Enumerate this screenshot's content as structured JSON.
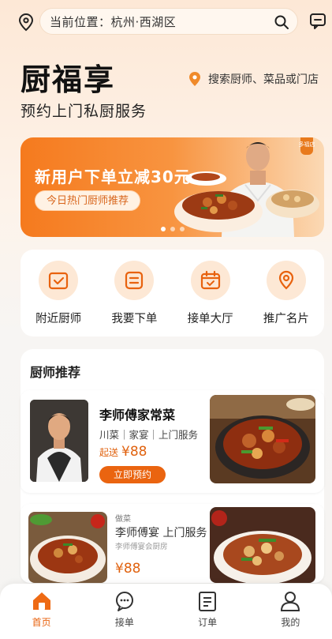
{
  "header": {
    "location_text": "当前位置：杭州·西湖区",
    "location_icon": "location-pin-icon",
    "search_icon": "search-icon",
    "message_icon": "message-icon"
  },
  "brand": {
    "title": "厨福享",
    "subtitle": "预约上门私厨服务",
    "search_link": "搜索厨师、菜品或门店"
  },
  "banner": {
    "title": "新用户下单立减30元",
    "chip": "今日热门厨师推荐",
    "badge": "多福店"
  },
  "quick_actions": [
    {
      "label": "附近厨师",
      "icon": "calendar-check-icon"
    },
    {
      "label": "我要下单",
      "icon": "order-list-icon"
    },
    {
      "label": "接单大厅",
      "icon": "folder-calendar-icon"
    },
    {
      "label": "推广名片",
      "icon": "map-pin-icon"
    }
  ],
  "section": {
    "title": "厨师推荐"
  },
  "chef_cards": [
    {
      "title": "李师傅家常菜",
      "tags": "川菜｜家宴｜上门服务",
      "price_prefix": "起送",
      "price": "¥88",
      "button": "立即预约"
    },
    {
      "tag": "做菜",
      "title": "李师傅宴 上门服务",
      "sub": "李师傅宴会厨房",
      "price": "¥88"
    }
  ],
  "tabbar": [
    {
      "label": "首页",
      "icon": "home-icon",
      "active": true
    },
    {
      "label": "接单",
      "icon": "chat-icon",
      "active": false
    },
    {
      "label": "订单",
      "icon": "clipboard-icon",
      "active": false
    },
    {
      "label": "我的",
      "icon": "user-icon",
      "active": false
    }
  ],
  "colors": {
    "accent": "#e8620e",
    "accent_light": "#fde8d5",
    "banner_start": "#f57a1e"
  }
}
